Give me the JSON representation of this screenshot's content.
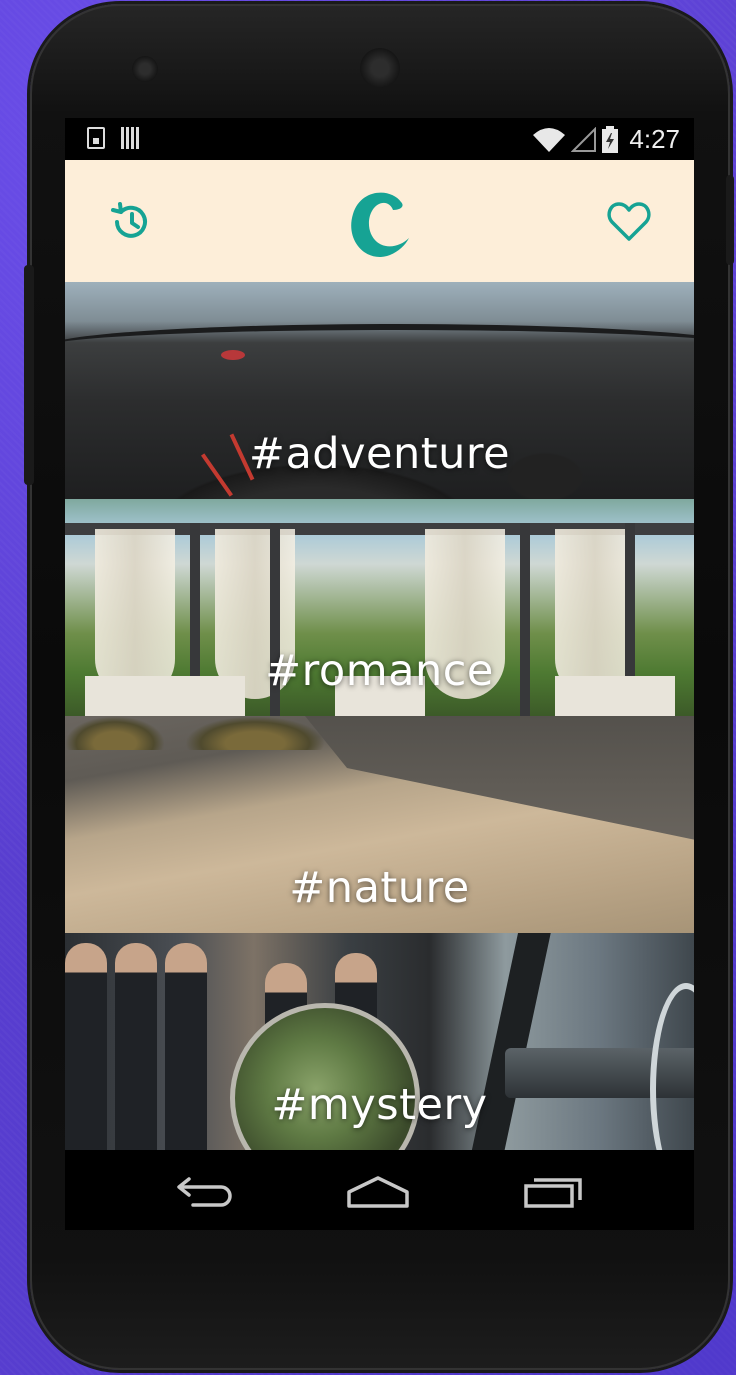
{
  "status_bar": {
    "time": "4:27",
    "icons": [
      "notification-icon",
      "barcode-icon",
      "wifi-icon",
      "signal-icon",
      "battery-icon"
    ]
  },
  "app_bar": {
    "left_icon": "history-icon",
    "logo_letter": "C",
    "right_icon": "heart-icon",
    "accent_color": "#16a394",
    "background_color": "#fdeed9"
  },
  "feed": {
    "items": [
      {
        "label": "#adventure"
      },
      {
        "label": "#romance"
      },
      {
        "label": "#nature"
      },
      {
        "label": "#mystery"
      }
    ]
  },
  "nav_bar": {
    "buttons": [
      "back-icon",
      "home-icon",
      "recents-icon"
    ]
  }
}
